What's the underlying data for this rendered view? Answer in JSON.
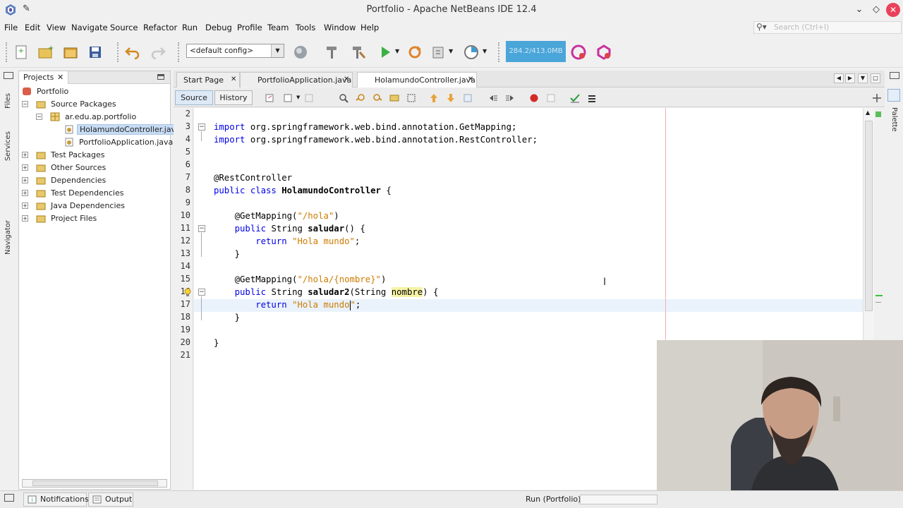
{
  "window": {
    "title": "Portfolio - Apache NetBeans IDE 12.4"
  },
  "menu": [
    "File",
    "Edit",
    "View",
    "Navigate",
    "Source",
    "Refactor",
    "Run",
    "Debug",
    "Profile",
    "Team",
    "Tools",
    "Window",
    "Help"
  ],
  "search": {
    "placeholder": "Search (Ctrl+I)"
  },
  "toolbar": {
    "config": "<default config>",
    "memory": "284.2/413.0MB"
  },
  "projects": {
    "tab_label": "Projects",
    "tree": [
      {
        "label": "Portfolio"
      },
      {
        "label": "Source Packages"
      },
      {
        "label": "ar.edu.ap.portfolio"
      },
      {
        "label": "HolamundoController.java",
        "selected": true
      },
      {
        "label": "PortfolioApplication.java"
      },
      {
        "label": "Test Packages"
      },
      {
        "label": "Other Sources"
      },
      {
        "label": "Dependencies"
      },
      {
        "label": "Test Dependencies"
      },
      {
        "label": "Java Dependencies"
      },
      {
        "label": "Project Files"
      }
    ]
  },
  "side_strip": {
    "left": [
      "Files",
      "Services",
      "Navigator"
    ],
    "right": [
      "Palette"
    ]
  },
  "editor": {
    "tabs": [
      {
        "label": "Start Page"
      },
      {
        "label": "PortfolioApplication.java"
      },
      {
        "label": "HolamundoController.java",
        "active": true
      }
    ],
    "source_label": "Source",
    "history_label": "History",
    "line_numbers": [
      "2",
      "3",
      "4",
      "5",
      "6",
      "7",
      "8",
      "9",
      "10",
      "11",
      "12",
      "13",
      "14",
      "15",
      "16",
      "17",
      "18",
      "19",
      "20",
      "21"
    ],
    "code": {
      "l3_kw": "import",
      "l3_rest": " org.springframework.web.bind.annotation.GetMapping;",
      "l4_kw": "import",
      "l4_rest": " org.springframework.web.bind.annotation.RestController;",
      "l7": "@RestController",
      "l8_kw": "public class",
      "l8_name": "HolamundoController",
      "l8_rest": " {",
      "l10_a": "    @GetMapping(",
      "l10_s": "\"/hola\"",
      "l10_b": ")",
      "l11_kw": "    public",
      "l11_a": " String ",
      "l11_name": "saludar",
      "l11_b": "() {",
      "l12_kw": "        return",
      "l12_sp": " ",
      "l12_s": "\"Hola mundo\"",
      "l12_b": ";",
      "l13": "    }",
      "l15_a": "    @GetMapping(",
      "l15_s": "\"/hola/{nombre}\"",
      "l15_b": ")",
      "l16_kw": "    public",
      "l16_a": " String ",
      "l16_name": "saludar2",
      "l16_b": "(String ",
      "l16_param": "nombre",
      "l16_c": ") {",
      "l17_kw": "        return",
      "l17_sp": " ",
      "l17_s": "\"Hola mundo",
      "l17_s2": "\"",
      "l17_b": ";",
      "l18": "    }",
      "l20": "}"
    }
  },
  "statusbar": {
    "notifications": "Notifications",
    "output": "Output",
    "run": "Run (Portfolio)"
  }
}
